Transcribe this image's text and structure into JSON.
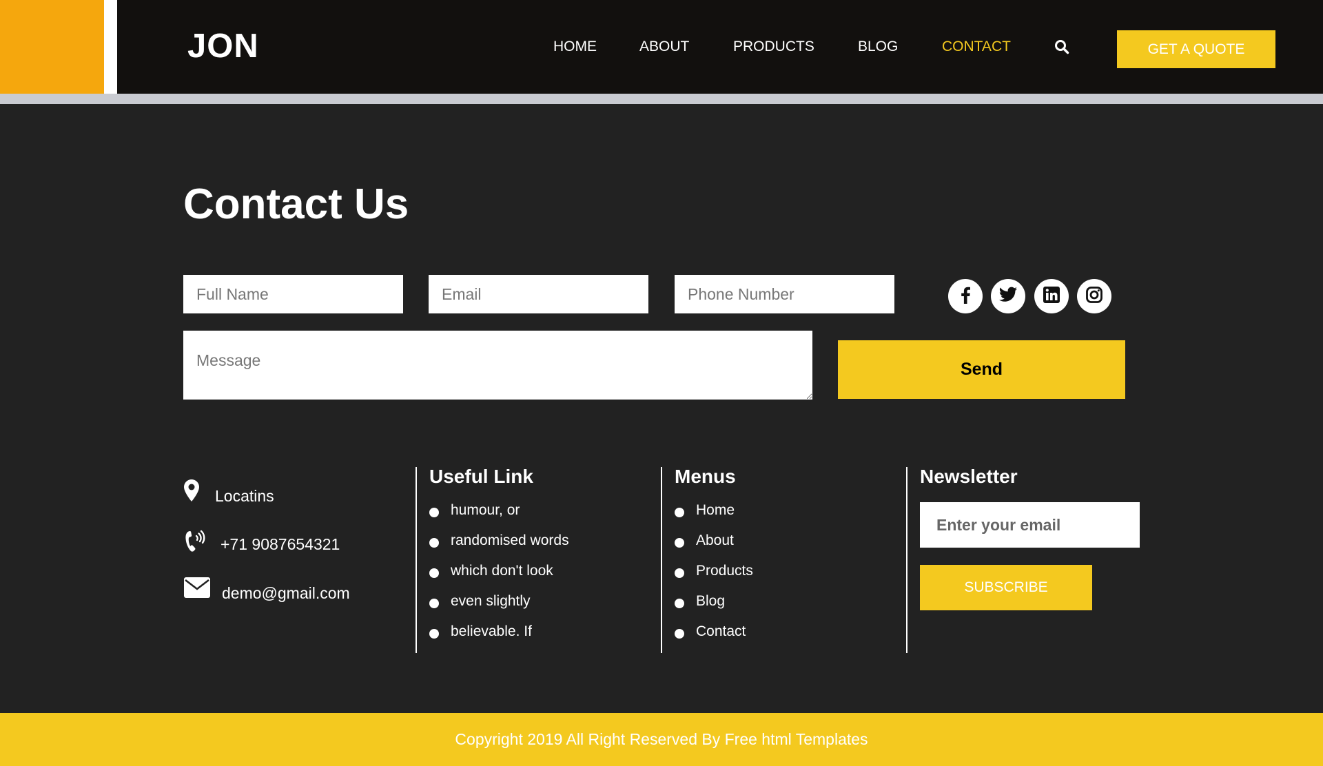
{
  "header": {
    "logo": "JON",
    "nav": [
      {
        "label": "HOME",
        "active": false
      },
      {
        "label": "ABOUT",
        "active": false
      },
      {
        "label": "PRODUCTS",
        "active": false
      },
      {
        "label": "BLOG",
        "active": false
      },
      {
        "label": "CONTACT",
        "active": true
      }
    ],
    "search_icon": "search-icon",
    "quote_button": "GET A QUOTE"
  },
  "contact": {
    "title": "Contact Us",
    "fields": {
      "full_name_placeholder": "Full Name",
      "email_placeholder": "Email",
      "phone_placeholder": "Phone Number",
      "message_placeholder": "Message"
    },
    "send_button": "Send",
    "social_icons": [
      "facebook-icon",
      "twitter-icon",
      "linkedin-icon",
      "instagram-icon"
    ]
  },
  "info": {
    "location": "Locatins",
    "phone": "+71 9087654321",
    "email": "demo@gmail.com"
  },
  "useful_links": {
    "title": "Useful Link",
    "items": [
      "humour, or",
      "randomised words",
      "which don't look",
      "even slightly",
      "believable. If"
    ]
  },
  "menus": {
    "title": "Menus",
    "items": [
      "Home",
      "About",
      "Products",
      "Blog",
      "Contact"
    ]
  },
  "newsletter": {
    "title": "Newsletter",
    "placeholder": "Enter your email",
    "button": "SUBSCRIBE"
  },
  "footer": {
    "copyright": "Copyright 2019 All Right Reserved By Free html Templates"
  },
  "colors": {
    "accent_yellow": "#f4c91f",
    "accent_orange": "#f5a70d",
    "header_bg": "#12100e",
    "section_bg": "#222222"
  }
}
